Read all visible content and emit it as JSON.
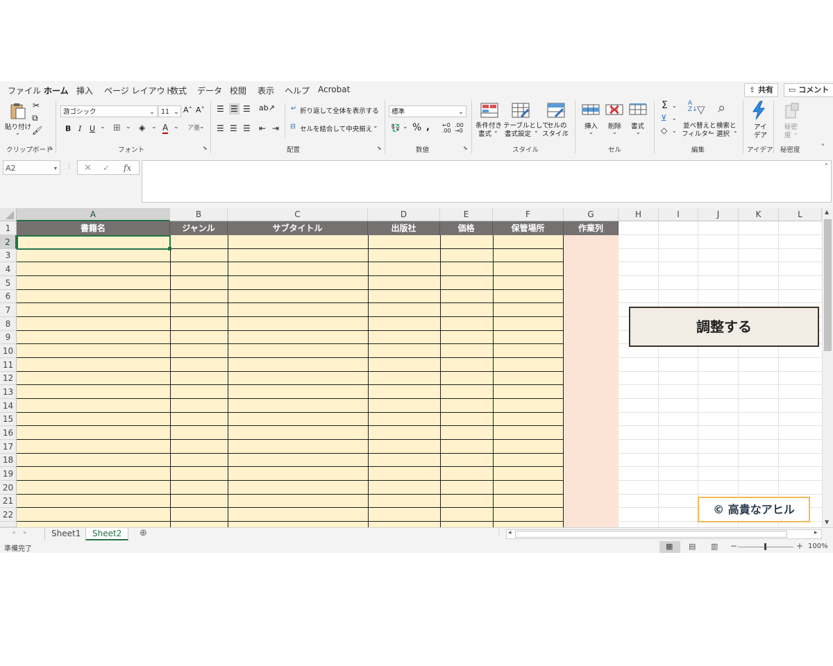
{
  "menu": {
    "tabs": [
      "ファイル",
      "ホーム",
      "挿入",
      "ページ レイアウト",
      "数式",
      "データ",
      "校閲",
      "表示",
      "ヘルプ",
      "Acrobat"
    ],
    "active_tab": "ホーム",
    "share_label": "共有",
    "comment_label": "コメント"
  },
  "ribbon": {
    "clipboard": {
      "paste_label": "貼り付け",
      "group_label": "クリップボード"
    },
    "font": {
      "font_name": "游ゴシック",
      "font_size": "11",
      "bold": "B",
      "italic": "I",
      "underline": "U",
      "group_label": "フォント"
    },
    "alignment": {
      "wrap_label": "折り返して全体を表示する",
      "merge_label": "セルを結合して中央揃え",
      "group_label": "配置"
    },
    "number": {
      "format_value": "標準",
      "group_label": "数値"
    },
    "styles": {
      "conditional_line1": "条件付き",
      "conditional_line2": "書式",
      "table_line1": "テーブルとして",
      "table_line2": "書式設定",
      "cell_line1": "セルの",
      "cell_line2": "スタイル",
      "group_label": "スタイル"
    },
    "cells": {
      "insert_label": "挿入",
      "delete_label": "削除",
      "format_label": "書式",
      "group_label": "セル"
    },
    "editing": {
      "sort_line1": "並べ替えと",
      "sort_line2": "フィルター",
      "find_line1": "検索と",
      "find_line2": "選択",
      "group_label": "編集"
    },
    "ideas": {
      "line1": "アイ",
      "line2": "デア",
      "group_label": "アイデア"
    },
    "sensitivity": {
      "line1": "秘密",
      "line2": "度",
      "group_label": "秘密度"
    }
  },
  "formula_bar": {
    "name_box": "A2",
    "fx": "fx",
    "formula_value": ""
  },
  "grid": {
    "columns": [
      "A",
      "B",
      "C",
      "D",
      "E",
      "F",
      "G",
      "H",
      "I",
      "J",
      "K",
      "L"
    ],
    "rows": [
      "1",
      "2",
      "3",
      "4",
      "5",
      "6",
      "7",
      "8",
      "9",
      "10",
      "11",
      "12",
      "13",
      "14",
      "15",
      "16",
      "17",
      "18",
      "19",
      "20",
      "21",
      "22"
    ],
    "header_row": [
      "書籍名",
      "ジャンル",
      "サブタイトル",
      "出版社",
      "価格",
      "保管場所",
      "作業列"
    ],
    "selected_cell": "A2"
  },
  "sheets": {
    "tabs": [
      "Sheet1",
      "Sheet2"
    ],
    "active": "Sheet2"
  },
  "status": {
    "ready_text": "準備完了",
    "zoom": "100%"
  },
  "overlay": {
    "adjust_label": "調整する",
    "credit": "© 高貴なアヒル"
  },
  "colors": {
    "header_fill": "#767171",
    "table_fill": "#fff2cc",
    "work_column_fill": "#fbe4d5",
    "accent": "#217346"
  }
}
